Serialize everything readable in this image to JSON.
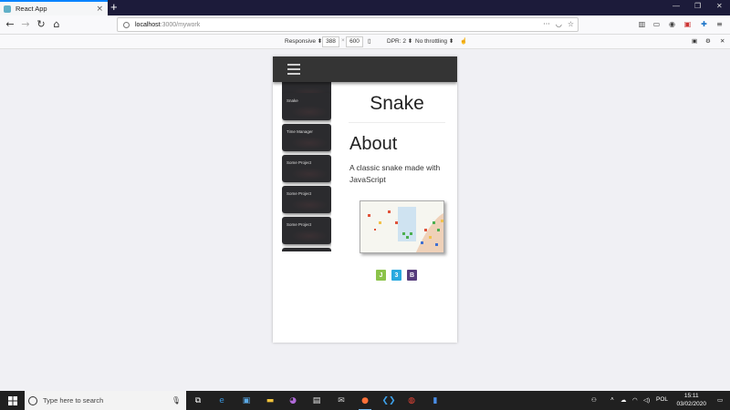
{
  "browser": {
    "tab_title": "React App",
    "tab_close": "×",
    "new_tab": "+",
    "url_host": "localhost",
    "url_path": ":3000/mywork"
  },
  "devtools": {
    "device_mode": "Responsive",
    "width": "388",
    "times": "×",
    "height": "600",
    "dpr": "DPR: 2",
    "throttling": "No throttling"
  },
  "app": {
    "sidebar_cards": [
      {
        "label": "Snake"
      },
      {
        "label": "Time Manager"
      },
      {
        "label": "Some Project"
      },
      {
        "label": "Some Project"
      },
      {
        "label": "Some Project"
      },
      {
        "label": ""
      }
    ],
    "project_title": "Snake",
    "about_heading": "About",
    "about_text": "A classic snake made with JavaScript",
    "tech_icons": [
      {
        "name": "js-icon",
        "glyph": "J",
        "color": "#8bc34a"
      },
      {
        "name": "css-icon",
        "glyph": "3",
        "color": "#29a9df"
      },
      {
        "name": "bootstrap-icon",
        "glyph": "B",
        "color": "#563d7c"
      }
    ]
  },
  "taskbar": {
    "search_placeholder": "Type here to search",
    "language": "POL",
    "time": "15:11",
    "date": "03/02/2020"
  }
}
